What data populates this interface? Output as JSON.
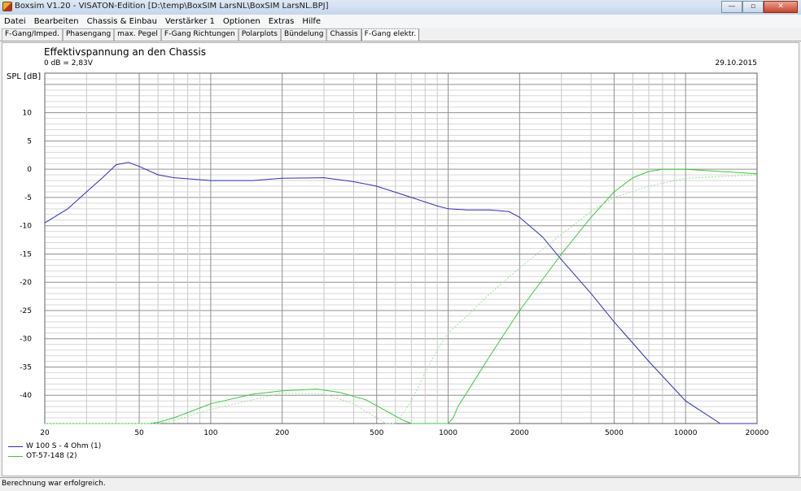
{
  "window": {
    "title": "Boxsim V1.20 - VISATON-Edition [D:\\temp\\BoxSIM LarsNL\\BoxSIM LarsNL.BPJ]",
    "buttons": {
      "minimize": "—",
      "maximize": "▫",
      "close": "✕"
    }
  },
  "menu": [
    "Datei",
    "Bearbeiten",
    "Chassis & Einbau",
    "Verstärker 1",
    "Optionen",
    "Extras",
    "Hilfe"
  ],
  "tabs": [
    "F-Gang/Imped.",
    "Phasengang",
    "max. Pegel",
    "F-Gang Richtungen",
    "Polarplots",
    "Bündelung",
    "Chassis",
    "F-Gang elektr."
  ],
  "active_tab": 7,
  "status": "Berechnung war erfolgreich.",
  "chart_data": {
    "type": "line",
    "title": "Effektivspannung an den Chassis",
    "subtitle": "0 dB = 2,83V",
    "date": "29.10.2015",
    "ylabel": "SPL [dB]",
    "xscale": "log",
    "xlim": [
      20,
      20000
    ],
    "ylim": [
      -45,
      17
    ],
    "grid": true,
    "legend_position": "bottom-left",
    "x_ticks": [
      20,
      50,
      100,
      200,
      500,
      1000,
      2000,
      5000,
      10000,
      20000
    ],
    "x_tick_labels": [
      "20",
      "50",
      "100",
      "200",
      "500",
      "1000",
      "2000",
      "5000",
      "10000",
      "20000"
    ],
    "y_ticks": [
      10,
      5,
      0,
      -5,
      -10,
      -15,
      -20,
      -25,
      -30,
      -35,
      -40
    ],
    "y_tick_labels": [
      "10",
      "5",
      "0",
      "-5",
      "-10",
      "-15",
      "-20",
      "-25",
      "-30",
      "-35",
      "-40"
    ],
    "colors": {
      "series1": "#3030b0",
      "series2": "#3cc83c",
      "series2_dotted": "#a0e0a0"
    },
    "series": [
      {
        "name": "W 100 S - 4 Ohm (1)",
        "color": "#3030b0",
        "style": "solid",
        "x": [
          20,
          25,
          30,
          35,
          40,
          45,
          50,
          60,
          70,
          100,
          150,
          200,
          300,
          400,
          500,
          700,
          900,
          1000,
          1200,
          1500,
          1800,
          2000,
          2500,
          3000,
          4000,
          5000,
          7000,
          10000,
          14000,
          16000,
          20000
        ],
        "y": [
          -9.5,
          -7,
          -4,
          -1.5,
          0.8,
          1.2,
          0.5,
          -1,
          -1.5,
          -2,
          -2,
          -1.6,
          -1.5,
          -2.2,
          -3,
          -5,
          -6.5,
          -7,
          -7.2,
          -7.2,
          -7.5,
          -8.5,
          -12,
          -16,
          -22,
          -27,
          -34,
          -41,
          -45,
          -45,
          -45
        ]
      },
      {
        "name": "OT-57-148 (2)",
        "color": "#3cc83c",
        "style": "solid",
        "x": [
          20,
          50,
          55,
          60,
          70,
          100,
          150,
          200,
          280,
          350,
          450,
          550,
          650,
          700,
          750,
          1000,
          1050,
          1100,
          1200,
          1500,
          2000,
          3000,
          4000,
          5000,
          6000,
          7000,
          8000,
          10000,
          20000
        ],
        "y": [
          -45,
          -45,
          -45,
          -44.8,
          -44,
          -41.5,
          -39.8,
          -39.2,
          -38.9,
          -39.5,
          -40.8,
          -42.8,
          -44.5,
          -45,
          -45,
          -45,
          -44,
          -42,
          -39.5,
          -33,
          -25,
          -15,
          -8.5,
          -4,
          -1.5,
          -0.4,
          0,
          0,
          -0.8
        ]
      },
      {
        "name": "",
        "color": "#a0e0a0",
        "style": "dotted",
        "x": [
          20,
          60,
          70,
          100,
          200,
          300,
          400,
          500,
          550,
          600,
          650,
          700,
          800,
          900,
          1000,
          1200,
          1500,
          2000,
          3000,
          4000,
          5000,
          7000,
          10000,
          20000
        ],
        "y": [
          -45,
          -45,
          -44.5,
          -42.5,
          -39.6,
          -39.8,
          -41.5,
          -44,
          -45,
          -45,
          -43,
          -41,
          -36,
          -32,
          -29,
          -26,
          -22,
          -17.5,
          -11.5,
          -7.5,
          -5,
          -3,
          -1.6,
          -1
        ]
      }
    ]
  }
}
